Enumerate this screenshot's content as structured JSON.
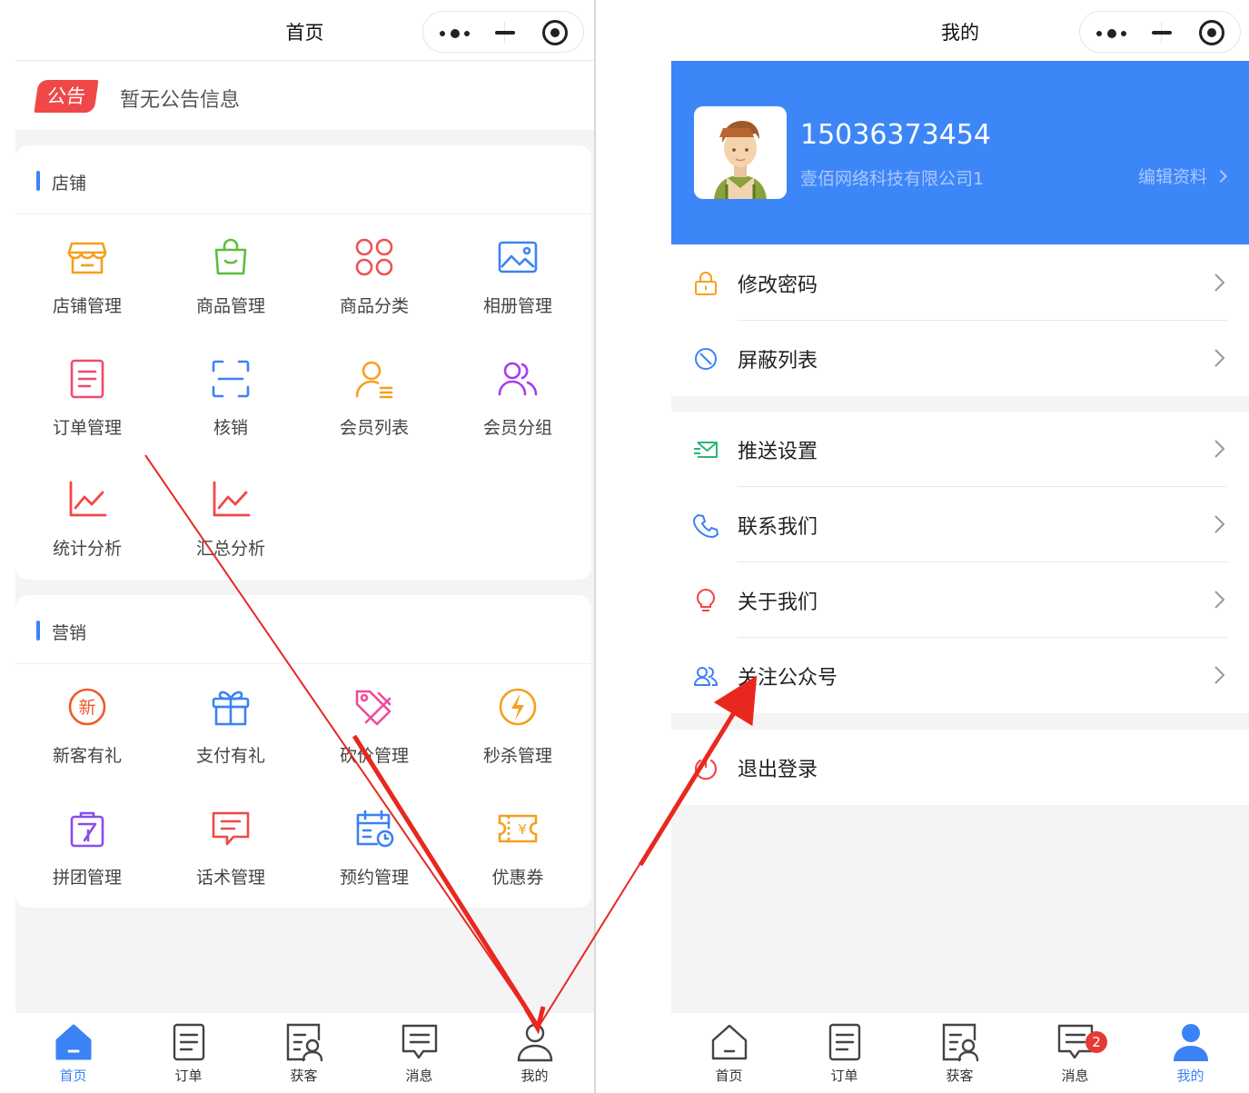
{
  "left": {
    "nav_title": "首页",
    "notice": {
      "badge": "公告",
      "text": "暂无公告信息"
    },
    "shop": {
      "title": "店铺",
      "items": [
        {
          "label": "店铺管理",
          "icon": "store-icon",
          "color": "#f5a01d"
        },
        {
          "label": "商品管理",
          "icon": "shopping-bag-icon",
          "color": "#5cbf3d"
        },
        {
          "label": "商品分类",
          "icon": "category-grid-icon",
          "color": "#f05252"
        },
        {
          "label": "相册管理",
          "icon": "photo-album-icon",
          "color": "#3b82f6"
        },
        {
          "label": "订单管理",
          "icon": "order-list-icon",
          "color": "#f04a6f"
        },
        {
          "label": "核销",
          "icon": "scan-verify-icon",
          "color": "#3b82f6"
        },
        {
          "label": "会员列表",
          "icon": "member-list-icon",
          "color": "#f5a01d"
        },
        {
          "label": "会员分组",
          "icon": "member-group-icon",
          "color": "#a63cf0"
        },
        {
          "label": "统计分析",
          "icon": "line-chart-icon",
          "color": "#f04848"
        },
        {
          "label": "汇总分析",
          "icon": "summary-chart-icon",
          "color": "#f04848"
        }
      ]
    },
    "marketing": {
      "title": "营销",
      "items": [
        {
          "label": "新客有礼",
          "icon": "new-customer-icon",
          "badge_text": "新",
          "color": "#f05a2a"
        },
        {
          "label": "支付有礼",
          "icon": "gift-icon",
          "color": "#3b82f6"
        },
        {
          "label": "砍价管理",
          "icon": "bargain-icon",
          "color": "#f04a9a"
        },
        {
          "label": "秒杀管理",
          "icon": "flash-sale-icon",
          "color": "#f5a01d"
        },
        {
          "label": "拼团管理",
          "icon": "group-buy-icon",
          "color": "#8a4cf0"
        },
        {
          "label": "话术管理",
          "icon": "script-message-icon",
          "color": "#f04848"
        },
        {
          "label": "预约管理",
          "icon": "appointment-calendar-icon",
          "color": "#3b82f6"
        },
        {
          "label": "优惠券",
          "icon": "coupon-icon",
          "color": "#f5a01d"
        }
      ]
    },
    "tabs": [
      {
        "label": "首页",
        "icon": "home-icon",
        "active": true
      },
      {
        "label": "订单",
        "icon": "order-icon",
        "active": false
      },
      {
        "label": "获客",
        "icon": "acquire-customer-icon",
        "active": false
      },
      {
        "label": "消息",
        "icon": "message-icon",
        "active": false
      },
      {
        "label": "我的",
        "icon": "user-icon",
        "active": false
      }
    ]
  },
  "right": {
    "nav_title": "我的",
    "profile": {
      "phone": "15036373454",
      "company": "壹佰网络科技有限公司1",
      "edit_label": "编辑资料",
      "avatar_icon": "avatar-icon"
    },
    "menu": [
      {
        "label": "修改密码",
        "icon": "lock-icon",
        "color": "#f5a01d"
      },
      {
        "label": "屏蔽列表",
        "icon": "block-icon",
        "color": "#3b82f6"
      },
      {
        "label": "推送设置",
        "icon": "push-envelope-icon",
        "color": "#2bb673"
      },
      {
        "label": "联系我们",
        "icon": "phone-icon",
        "color": "#3b82f6"
      },
      {
        "label": "关于我们",
        "icon": "bulb-icon",
        "color": "#f04848"
      },
      {
        "label": "关注公众号",
        "icon": "follow-icon",
        "color": "#3b82f6"
      },
      {
        "label": "退出登录",
        "icon": "power-icon",
        "color": "#f04848"
      }
    ],
    "tabs": [
      {
        "label": "首页",
        "icon": "home-icon",
        "active": false
      },
      {
        "label": "订单",
        "icon": "order-icon",
        "active": false
      },
      {
        "label": "获客",
        "icon": "acquire-customer-icon",
        "active": false
      },
      {
        "label": "消息",
        "icon": "message-icon",
        "active": false,
        "badge": "2"
      },
      {
        "label": "我的",
        "icon": "user-icon",
        "active": true
      }
    ]
  },
  "colors": {
    "accent": "#3b82f6",
    "profile_bg": "#3d86f7",
    "annotation": "#e8281f"
  }
}
